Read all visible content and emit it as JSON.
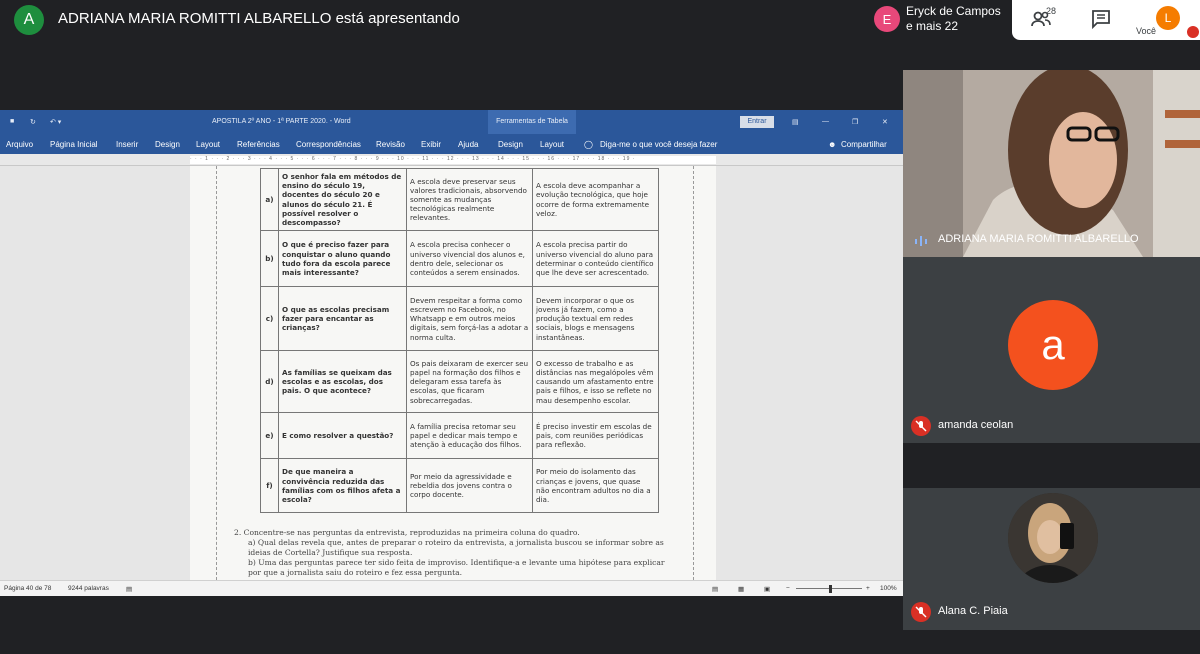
{
  "meet": {
    "presenter_initial": "A",
    "presenter_text": "ADRIANA MARIA ROMITTI ALBARELLO está apresentando",
    "others_initial": "E",
    "others_line1": "Eryck de Campos",
    "others_line2": "e mais 22",
    "people_count": "28",
    "self_initial": "L",
    "self_label": "Você"
  },
  "word": {
    "doc_title": "APOSTILA 2º ANO - 1ª PARTE 2020. - Word",
    "context_tab": "Ferramentas de Tabela",
    "signin": "Entrar",
    "ribbon": [
      "Arquivo",
      "Página Inicial",
      "Inserir",
      "Design",
      "Layout",
      "Referências",
      "Correspondências",
      "Revisão",
      "Exibir",
      "Ajuda",
      "Design",
      "Layout"
    ],
    "tell_me": "Diga-me o que você deseja fazer",
    "share": "Compartilhar",
    "status_page": "Página 40 de 78",
    "status_words": "9244 palavras",
    "zoom": "100%"
  },
  "document": {
    "rows": [
      {
        "letter": "a)",
        "q": "O senhor fala em métodos de ensino do século 19, docentes do século 20 e alunos do século 21. É possível resolver o descompasso?",
        "a1": "A escola deve preservar seus valores tradicionais, absorvendo somente as mudanças tecnológicas realmente relevantes.",
        "a2": "A escola deve acompanhar a evolução tecnológica, que hoje ocorre de forma extremamente veloz."
      },
      {
        "letter": "b)",
        "q": "O que é preciso fazer para conquistar o aluno quando tudo fora da escola parece mais interessante?",
        "a1": "A escola precisa conhecer o universo vivencial dos alunos e, dentro dele, selecionar os conteúdos a serem ensinados.",
        "a2": "A escola precisa partir do universo vivencial do aluno para determinar o conteúdo científico que lhe deve ser acrescentado."
      },
      {
        "letter": "c)",
        "q": "O que as escolas precisam fazer para encantar as crianças?",
        "a1": "Devem respeitar a forma como escrevem no Facebook, no Whatsapp e em outros meios digitais, sem forçá-las a adotar a norma culta.",
        "a2": "Devem incorporar o que os jovens já fazem, como a produção textual em redes sociais, blogs e mensagens instantâneas."
      },
      {
        "letter": "d)",
        "q": "As famílias se queixam das escolas e as escolas, dos pais. O que acontece?",
        "a1": "Os pais deixaram de exercer seu papel na formação dos filhos e delegaram essa tarefa às escolas, que ficaram sobrecarregadas.",
        "a2": "O excesso de trabalho e as distâncias nas megalópoles vêm causando um afastamento entre pais e filhos, e isso se reflete no mau desempenho escolar."
      },
      {
        "letter": "e)",
        "q": "E como resolver a questão?",
        "a1": "A família precisa retomar seu papel e dedicar mais tempo e atenção à educação dos filhos.",
        "a2": "É preciso investir em escolas de pais, com reuniões periódicas para reflexão."
      },
      {
        "letter": "f)",
        "q": "De que maneira a convivência reduzida das famílias com os filhos afeta a escola?",
        "a1": "Por meio da agressividade e rebeldia dos jovens contra o corpo docente.",
        "a2": "Por meio do isolamento das crianças e jovens, que quase não encontram adultos no dia a dia."
      }
    ],
    "q2_line1": "2.  Concentre-se nas perguntas da entrevista, reproduzidas na primeira coluna do quadro.",
    "q2_a": "a) Qual delas revela que, antes de preparar o roteiro da entrevista, a jornalista buscou se informar sobre as ideias de Cortella? Justifique sua resposta.",
    "q2_b": "b) Uma das perguntas parece ter sido feita de improviso. Identifique-a e levante uma hipótese para explicar por que a jornalista saiu do roteiro e fez essa pergunta."
  },
  "participants": [
    {
      "name": "ADRIANA MARIA ROMITTI ALBARELLO"
    },
    {
      "name": "amanda ceolan",
      "initial": "a"
    },
    {
      "name": "Alana C. Piaia"
    }
  ],
  "colors": {
    "meet_bg": "#202124",
    "tile_bg": "#3c4043",
    "word_blue": "#2b579a",
    "mic_off": "#d93025"
  }
}
